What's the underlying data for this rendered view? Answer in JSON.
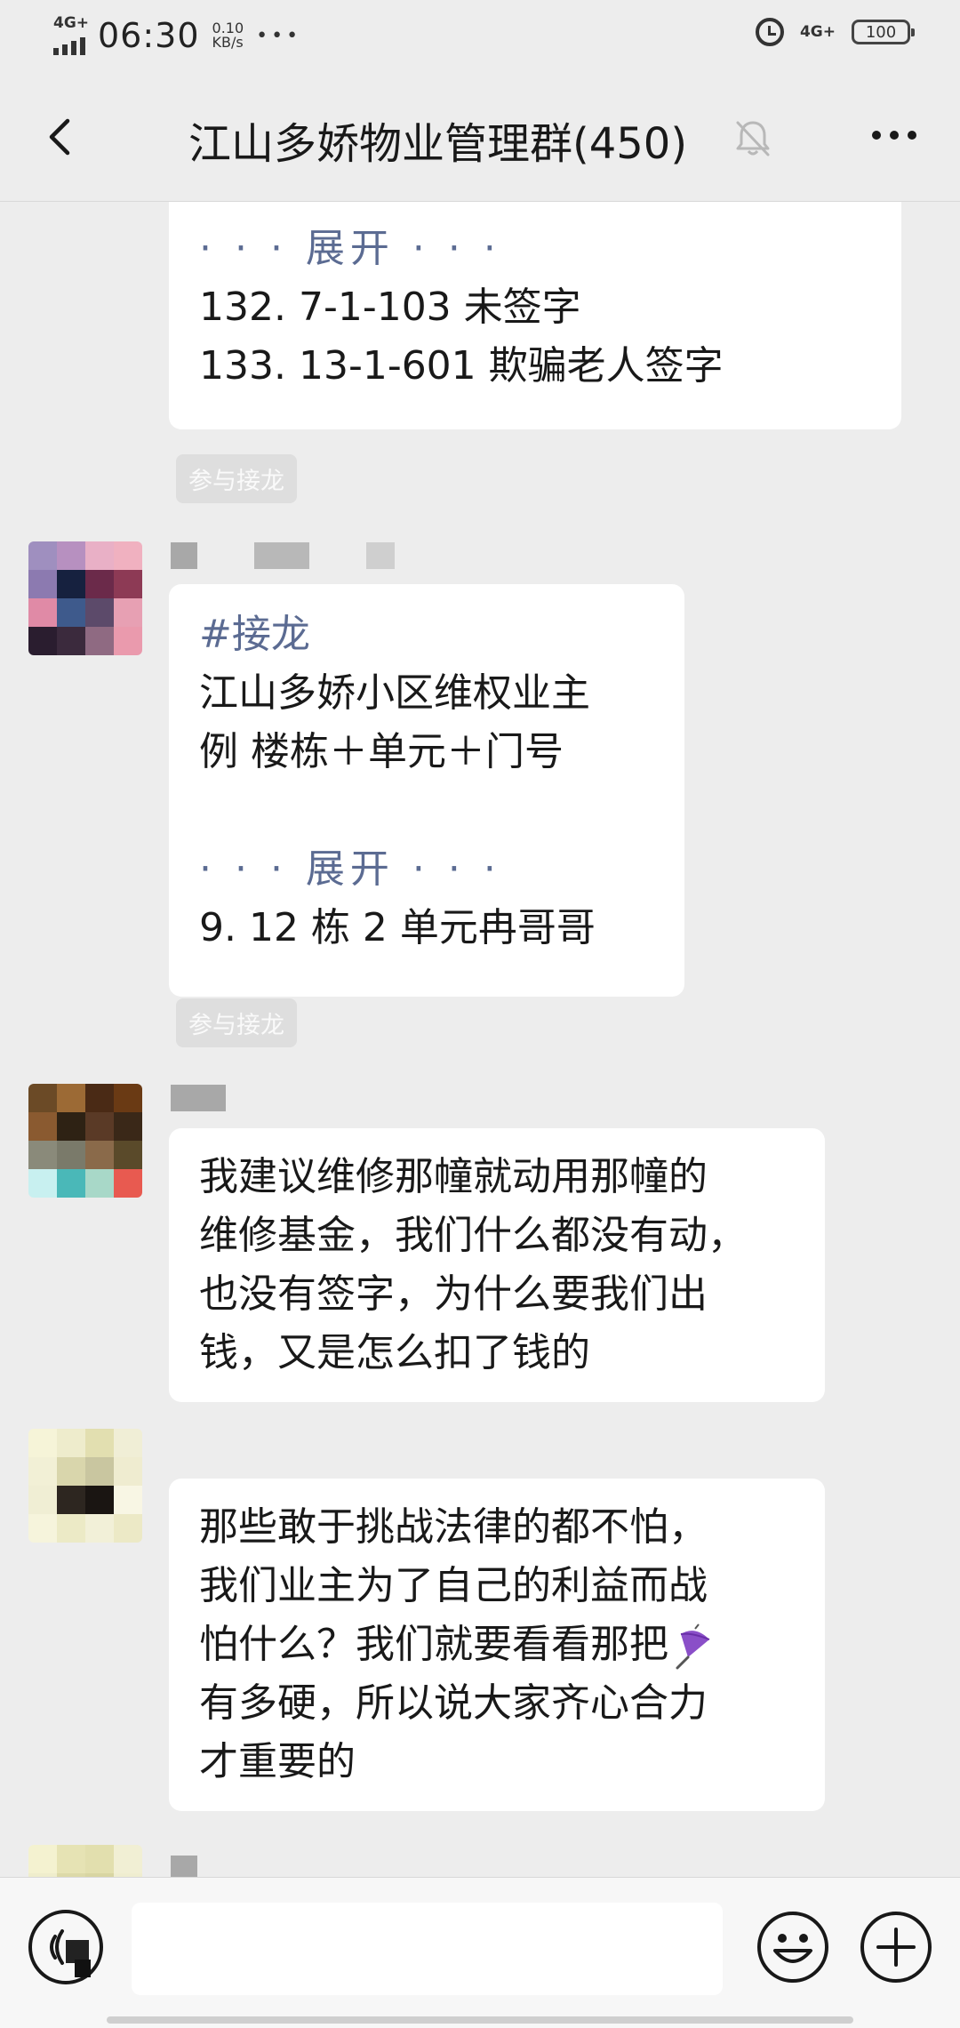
{
  "status_bar": {
    "network_left": "4G+",
    "time": "06:30",
    "speed_value": "0.10",
    "speed_unit": "KB/s",
    "more": "•••",
    "network_right": "4G+",
    "battery": "100"
  },
  "nav": {
    "back_icon": "chevron-left-icon",
    "title": "江山多娇物业管理群(450)",
    "mute_icon": "bell-off-icon",
    "more_icon": "ellipsis-icon"
  },
  "messages": [
    {
      "lines": [
        "· · · 展开 · · ·",
        "132. 7-1-103 未签字",
        "133. 13-1-601 欺骗老人签字"
      ]
    },
    {
      "chip": "参与接龙"
    },
    {
      "lines": [
        "#接龙",
        "江山多娇小区维权业主",
        "例 楼栋＋单元＋门号",
        "",
        "· · · 展开 · · ·",
        "9. 12 栋 2 单元冉哥哥"
      ]
    },
    {
      "chip": "参与接龙"
    },
    {
      "lines": [
        "我建议维修那幢就动用那幢的",
        "维修基金，我们什么都没有动，",
        "也没有签字，为什么要我们出",
        "钱，又是怎么扣了钱的"
      ]
    },
    {
      "lines": [
        "那些敢于挑战法律的都不怕，",
        "我们业主为了自己的利益而战",
        "怕什么？我们就要看看那把",
        "有多硬，所以说大家齐心合力",
        "才重要的"
      ],
      "emoji": "umbrella-emoji"
    }
  ],
  "input_bar": {
    "voice_icon": "voice-icon",
    "emoji_icon": "smiley-icon",
    "plus_icon": "plus-circle-icon"
  },
  "colors": {
    "background": "#ededed",
    "bubble": "#ffffff",
    "link": "#5b6b92",
    "chip": "#dedede"
  }
}
